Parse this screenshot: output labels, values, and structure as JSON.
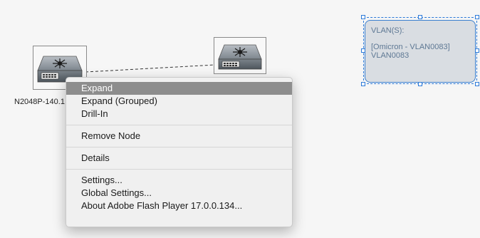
{
  "canvas": {
    "background_color": "#f6f6f6",
    "selection_color": "#2b79d8"
  },
  "nodes": [
    {
      "label": "N2048P-140.1",
      "icon": "network-switch-icon"
    },
    {
      "label": "",
      "icon": "network-switch-icon"
    }
  ],
  "vlan_panel": {
    "title": "VLAN(S):",
    "line1": "[Omicron - VLAN0083]",
    "line2": "VLAN0083"
  },
  "context_menu": {
    "highlight_color": "#8d8d8d",
    "group1": [
      {
        "label": "Expand",
        "highlighted": true
      },
      {
        "label": "Expand (Grouped)",
        "highlighted": false
      },
      {
        "label": "Drill-In",
        "highlighted": false
      }
    ],
    "group2": [
      {
        "label": "Remove Node",
        "highlighted": false
      }
    ],
    "group3": [
      {
        "label": "Details",
        "highlighted": false
      }
    ],
    "group4": [
      {
        "label": "Settings...",
        "highlighted": false
      },
      {
        "label": "Global Settings...",
        "highlighted": false
      },
      {
        "label": "About Adobe Flash Player 17.0.0.134...",
        "highlighted": false
      }
    ]
  }
}
